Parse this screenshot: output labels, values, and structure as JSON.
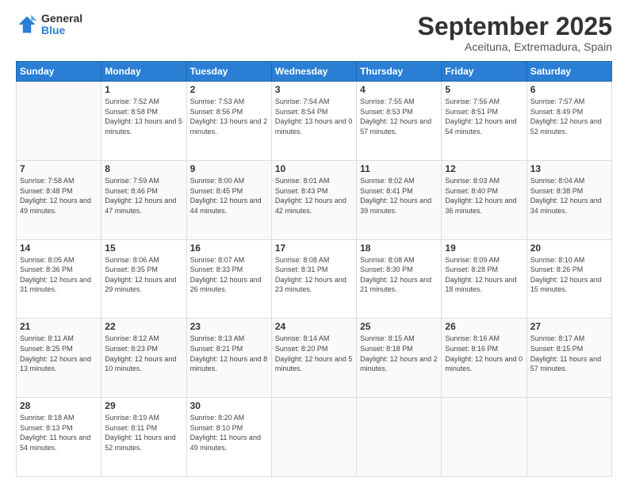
{
  "logo": {
    "general": "General",
    "blue": "Blue"
  },
  "header": {
    "month": "September 2025",
    "location": "Aceituna, Extremadura, Spain"
  },
  "weekdays": [
    "Sunday",
    "Monday",
    "Tuesday",
    "Wednesday",
    "Thursday",
    "Friday",
    "Saturday"
  ],
  "weeks": [
    [
      {
        "day": "",
        "sunrise": "",
        "sunset": "",
        "daylight": ""
      },
      {
        "day": "1",
        "sunrise": "Sunrise: 7:52 AM",
        "sunset": "Sunset: 8:58 PM",
        "daylight": "Daylight: 13 hours and 5 minutes."
      },
      {
        "day": "2",
        "sunrise": "Sunrise: 7:53 AM",
        "sunset": "Sunset: 8:56 PM",
        "daylight": "Daylight: 13 hours and 2 minutes."
      },
      {
        "day": "3",
        "sunrise": "Sunrise: 7:54 AM",
        "sunset": "Sunset: 8:54 PM",
        "daylight": "Daylight: 13 hours and 0 minutes."
      },
      {
        "day": "4",
        "sunrise": "Sunrise: 7:55 AM",
        "sunset": "Sunset: 8:53 PM",
        "daylight": "Daylight: 12 hours and 57 minutes."
      },
      {
        "day": "5",
        "sunrise": "Sunrise: 7:56 AM",
        "sunset": "Sunset: 8:51 PM",
        "daylight": "Daylight: 12 hours and 54 minutes."
      },
      {
        "day": "6",
        "sunrise": "Sunrise: 7:57 AM",
        "sunset": "Sunset: 8:49 PM",
        "daylight": "Daylight: 12 hours and 52 minutes."
      }
    ],
    [
      {
        "day": "7",
        "sunrise": "Sunrise: 7:58 AM",
        "sunset": "Sunset: 8:48 PM",
        "daylight": "Daylight: 12 hours and 49 minutes."
      },
      {
        "day": "8",
        "sunrise": "Sunrise: 7:59 AM",
        "sunset": "Sunset: 8:46 PM",
        "daylight": "Daylight: 12 hours and 47 minutes."
      },
      {
        "day": "9",
        "sunrise": "Sunrise: 8:00 AM",
        "sunset": "Sunset: 8:45 PM",
        "daylight": "Daylight: 12 hours and 44 minutes."
      },
      {
        "day": "10",
        "sunrise": "Sunrise: 8:01 AM",
        "sunset": "Sunset: 8:43 PM",
        "daylight": "Daylight: 12 hours and 42 minutes."
      },
      {
        "day": "11",
        "sunrise": "Sunrise: 8:02 AM",
        "sunset": "Sunset: 8:41 PM",
        "daylight": "Daylight: 12 hours and 39 minutes."
      },
      {
        "day": "12",
        "sunrise": "Sunrise: 8:03 AM",
        "sunset": "Sunset: 8:40 PM",
        "daylight": "Daylight: 12 hours and 36 minutes."
      },
      {
        "day": "13",
        "sunrise": "Sunrise: 8:04 AM",
        "sunset": "Sunset: 8:38 PM",
        "daylight": "Daylight: 12 hours and 34 minutes."
      }
    ],
    [
      {
        "day": "14",
        "sunrise": "Sunrise: 8:05 AM",
        "sunset": "Sunset: 8:36 PM",
        "daylight": "Daylight: 12 hours and 31 minutes."
      },
      {
        "day": "15",
        "sunrise": "Sunrise: 8:06 AM",
        "sunset": "Sunset: 8:35 PM",
        "daylight": "Daylight: 12 hours and 29 minutes."
      },
      {
        "day": "16",
        "sunrise": "Sunrise: 8:07 AM",
        "sunset": "Sunset: 8:33 PM",
        "daylight": "Daylight: 12 hours and 26 minutes."
      },
      {
        "day": "17",
        "sunrise": "Sunrise: 8:08 AM",
        "sunset": "Sunset: 8:31 PM",
        "daylight": "Daylight: 12 hours and 23 minutes."
      },
      {
        "day": "18",
        "sunrise": "Sunrise: 8:08 AM",
        "sunset": "Sunset: 8:30 PM",
        "daylight": "Daylight: 12 hours and 21 minutes."
      },
      {
        "day": "19",
        "sunrise": "Sunrise: 8:09 AM",
        "sunset": "Sunset: 8:28 PM",
        "daylight": "Daylight: 12 hours and 18 minutes."
      },
      {
        "day": "20",
        "sunrise": "Sunrise: 8:10 AM",
        "sunset": "Sunset: 8:26 PM",
        "daylight": "Daylight: 12 hours and 15 minutes."
      }
    ],
    [
      {
        "day": "21",
        "sunrise": "Sunrise: 8:11 AM",
        "sunset": "Sunset: 8:25 PM",
        "daylight": "Daylight: 12 hours and 13 minutes."
      },
      {
        "day": "22",
        "sunrise": "Sunrise: 8:12 AM",
        "sunset": "Sunset: 8:23 PM",
        "daylight": "Daylight: 12 hours and 10 minutes."
      },
      {
        "day": "23",
        "sunrise": "Sunrise: 8:13 AM",
        "sunset": "Sunset: 8:21 PM",
        "daylight": "Daylight: 12 hours and 8 minutes."
      },
      {
        "day": "24",
        "sunrise": "Sunrise: 8:14 AM",
        "sunset": "Sunset: 8:20 PM",
        "daylight": "Daylight: 12 hours and 5 minutes."
      },
      {
        "day": "25",
        "sunrise": "Sunrise: 8:15 AM",
        "sunset": "Sunset: 8:18 PM",
        "daylight": "Daylight: 12 hours and 2 minutes."
      },
      {
        "day": "26",
        "sunrise": "Sunrise: 8:16 AM",
        "sunset": "Sunset: 8:16 PM",
        "daylight": "Daylight: 12 hours and 0 minutes."
      },
      {
        "day": "27",
        "sunrise": "Sunrise: 8:17 AM",
        "sunset": "Sunset: 8:15 PM",
        "daylight": "Daylight: 11 hours and 57 minutes."
      }
    ],
    [
      {
        "day": "28",
        "sunrise": "Sunrise: 8:18 AM",
        "sunset": "Sunset: 8:13 PM",
        "daylight": "Daylight: 11 hours and 54 minutes."
      },
      {
        "day": "29",
        "sunrise": "Sunrise: 8:19 AM",
        "sunset": "Sunset: 8:11 PM",
        "daylight": "Daylight: 11 hours and 52 minutes."
      },
      {
        "day": "30",
        "sunrise": "Sunrise: 8:20 AM",
        "sunset": "Sunset: 8:10 PM",
        "daylight": "Daylight: 11 hours and 49 minutes."
      },
      {
        "day": "",
        "sunrise": "",
        "sunset": "",
        "daylight": ""
      },
      {
        "day": "",
        "sunrise": "",
        "sunset": "",
        "daylight": ""
      },
      {
        "day": "",
        "sunrise": "",
        "sunset": "",
        "daylight": ""
      },
      {
        "day": "",
        "sunrise": "",
        "sunset": "",
        "daylight": ""
      }
    ]
  ]
}
